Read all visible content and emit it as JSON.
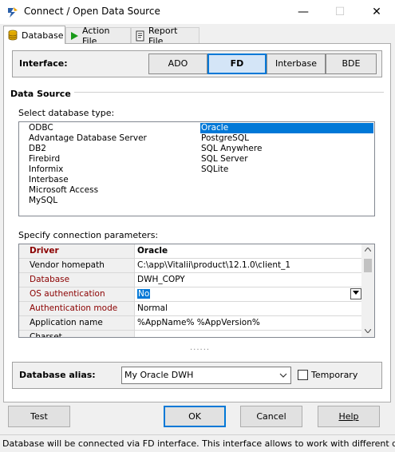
{
  "window": {
    "title": "Connect / Open Data Source",
    "minimize": "—",
    "maximize": "☐",
    "close": "✕"
  },
  "tabs": [
    {
      "label": "Database",
      "icon": "database-icon",
      "active": true
    },
    {
      "label": "Action File",
      "icon": "play-icon",
      "active": false
    },
    {
      "label": "Report File",
      "icon": "report-icon",
      "active": false
    }
  ],
  "interface": {
    "label": "Interface:",
    "options": [
      "ADO",
      "FD",
      "Interbase",
      "BDE"
    ],
    "selected": "FD"
  },
  "data_source": {
    "title": "Data Source",
    "select_label": "Select database type:",
    "column_left": [
      "ODBC",
      "Advantage Database Server",
      "DB2",
      "Firebird",
      "Informix",
      "Interbase",
      "Microsoft Access",
      "MySQL"
    ],
    "column_right": [
      "Oracle",
      "PostgreSQL",
      "SQL Anywhere",
      "SQL Server",
      "SQLite"
    ],
    "selected": "Oracle",
    "params_label": "Specify connection parameters:"
  },
  "params": [
    {
      "key": "Driver",
      "value": "Oracle",
      "required": true,
      "header": true
    },
    {
      "key": "Vendor homepath",
      "value": "C:\\app\\Vitalii\\product\\12.1.0\\client_1",
      "required": false
    },
    {
      "key": "Database",
      "value": "DWH_COPY",
      "required": true
    },
    {
      "key": "OS authentication",
      "value": "No",
      "required": true,
      "editing": true
    },
    {
      "key": "Authentication mode",
      "value": "Normal",
      "required": true
    },
    {
      "key": "Application name",
      "value": "%AppName% %AppVersion%",
      "required": false
    },
    {
      "key": "Charset",
      "value": "",
      "required": false
    }
  ],
  "resize_handle": "......",
  "alias": {
    "label": "Database alias:",
    "value": "My Oracle DWH",
    "temporary_label": "Temporary",
    "temporary_checked": false
  },
  "buttons": {
    "test": "Test",
    "ok": "OK",
    "cancel": "Cancel",
    "help": "Help"
  },
  "status": "Database will be connected via FD interface. This interface allows to work with different da",
  "colors": {
    "accent": "#0078d7",
    "required_label": "#8b0000"
  }
}
